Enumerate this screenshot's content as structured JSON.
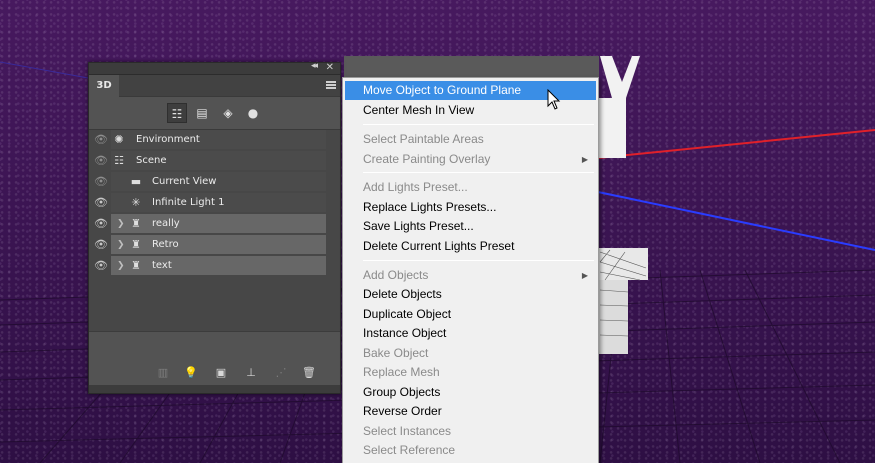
{
  "panel": {
    "tab_label": "3D",
    "layers": [
      {
        "name": "Environment",
        "icon": "environment-icon",
        "visible": true
      },
      {
        "name": "Scene",
        "icon": "scene-icon",
        "visible": true
      },
      {
        "name": "Current View",
        "icon": "camera-icon",
        "visible": true
      },
      {
        "name": "Infinite Light 1",
        "icon": "light-icon",
        "visible": true
      },
      {
        "name": "really",
        "icon": "mesh-icon",
        "visible": true,
        "selected": true
      },
      {
        "name": "Retro",
        "icon": "mesh-icon",
        "visible": true,
        "selected": true
      },
      {
        "name": "text",
        "icon": "mesh-icon",
        "visible": true,
        "selected": true
      }
    ]
  },
  "menu": {
    "items": [
      {
        "label": "Move Object to Ground Plane",
        "state": "highlighted"
      },
      {
        "label": "Center Mesh In View",
        "state": "enabled"
      },
      {
        "separator": true
      },
      {
        "label": "Select Paintable Areas",
        "state": "disabled"
      },
      {
        "label": "Create Painting Overlay",
        "state": "disabled",
        "submenu": true
      },
      {
        "separator": true
      },
      {
        "label": "Add Lights Preset...",
        "state": "disabled"
      },
      {
        "label": "Replace Lights Presets...",
        "state": "enabled"
      },
      {
        "label": "Save Lights Preset...",
        "state": "enabled"
      },
      {
        "label": "Delete Current Lights Preset",
        "state": "enabled"
      },
      {
        "separator": true
      },
      {
        "label": "Add Objects",
        "state": "disabled",
        "submenu": true
      },
      {
        "label": "Delete Objects",
        "state": "enabled"
      },
      {
        "label": "Duplicate Object",
        "state": "enabled"
      },
      {
        "label": "Instance Object",
        "state": "enabled"
      },
      {
        "label": "Bake Object",
        "state": "disabled"
      },
      {
        "label": "Replace Mesh",
        "state": "disabled"
      },
      {
        "label": "Group Objects",
        "state": "enabled"
      },
      {
        "label": "Reverse Order",
        "state": "enabled"
      },
      {
        "label": "Select Instances",
        "state": "disabled"
      },
      {
        "label": "Select Reference",
        "state": "disabled"
      }
    ]
  },
  "colors": {
    "background": "#3a1452",
    "menu_highlight": "#3a8ee6",
    "axis_red": "#e0202a",
    "axis_blue": "#2a3cff"
  }
}
